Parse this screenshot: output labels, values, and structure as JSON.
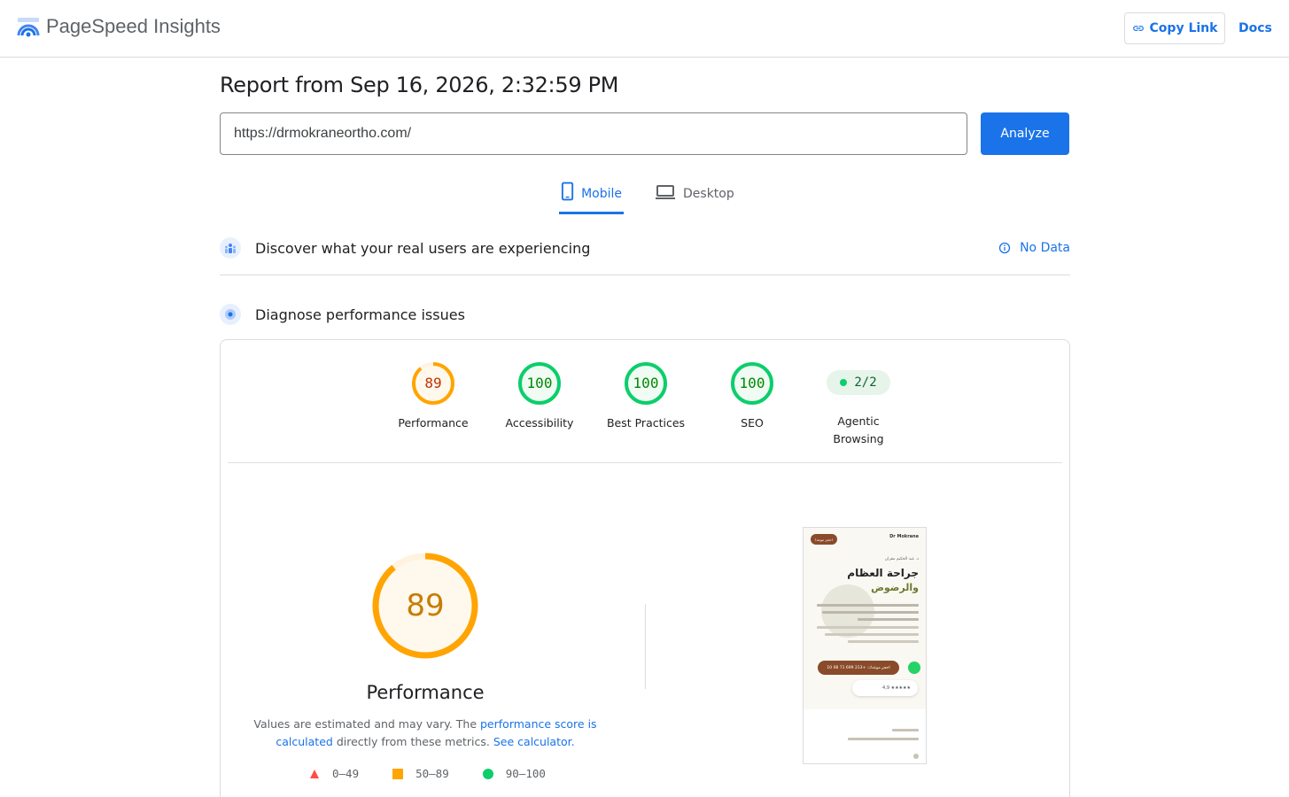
{
  "header": {
    "app_title": "PageSpeed Insights",
    "copy_link_label": "Copy Link",
    "docs_label": "Docs"
  },
  "report": {
    "title": "Report from Sep 16, 2026, 2:32:59 PM",
    "url_value": "https://drmokraneortho.com/",
    "analyze_label": "Analyze"
  },
  "tabs": [
    {
      "label": "Mobile",
      "active": true
    },
    {
      "label": "Desktop",
      "active": false
    }
  ],
  "real_users": {
    "title": "Discover what your real users are experiencing",
    "status": "No Data"
  },
  "diagnose": {
    "title": "Diagnose performance issues"
  },
  "scores": [
    {
      "label": "Performance",
      "value": "89",
      "fraction": 0.89,
      "color": "#ffa400",
      "text_color": "#c33300"
    },
    {
      "label": "Accessibility",
      "value": "100",
      "fraction": 1.0,
      "color": "#0cce6b",
      "text_color": "#008800"
    },
    {
      "label": "Best Practices",
      "value": "100",
      "fraction": 1.0,
      "color": "#0cce6b",
      "text_color": "#008800"
    },
    {
      "label": "SEO",
      "value": "100",
      "fraction": 1.0,
      "color": "#0cce6b",
      "text_color": "#008800"
    }
  ],
  "agentic": {
    "value": "2/2",
    "label_line1": "Agentic",
    "label_line2": "Browsing"
  },
  "performance": {
    "score": "89",
    "fraction": 0.89,
    "title": "Performance",
    "note_prefix": "Values are estimated and may vary. The ",
    "note_link1": "performance score is calculated",
    "note_middle": " directly from these metrics. ",
    "note_link2": "See calculator.",
    "legend": [
      {
        "range": "0–49",
        "shape": "triangle",
        "color": "#ff4e42"
      },
      {
        "range": "50–89",
        "shape": "square",
        "color": "#ffa400"
      },
      {
        "range": "90–100",
        "shape": "circle",
        "color": "#0cce6b"
      }
    ]
  },
  "thumbnail": {
    "brand": "Dr Mokrane",
    "top_button": "احجز موعدا",
    "subtitle": "د. عبد الحكيم مقران",
    "heading1": "جراحة العظام",
    "heading2": "والرضوض",
    "cta": "احجز موعدك: +213 699 71 08 10",
    "rating": "4,9 ★★★★★"
  },
  "colors": {
    "accent": "#1a73e8",
    "average": "#ffa400",
    "good": "#0cce6b",
    "poor": "#ff4e42"
  }
}
